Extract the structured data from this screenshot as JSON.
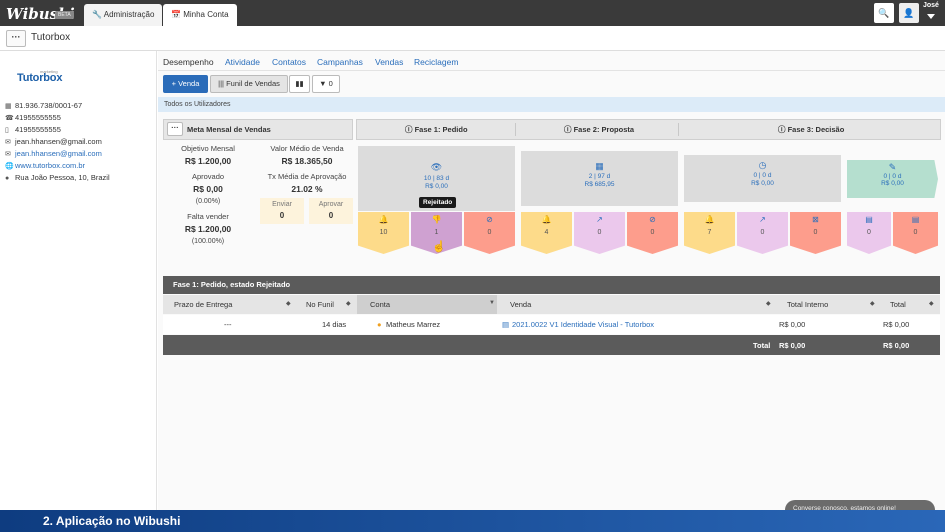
{
  "app": {
    "logo": "Wibushi",
    "beta": "BETA",
    "tabs": [
      {
        "label": "Administração"
      },
      {
        "label": "Minha Conta"
      }
    ],
    "username": "José"
  },
  "breadcrumb": {
    "title": "Tutorbox"
  },
  "company": {
    "tagline": "marketing",
    "name": "Tutorbox",
    "cnpj": "81.936.738/0001-67",
    "phone1": "41955555555",
    "phone2": "41955555555",
    "email1": "jean.hhansen@gmail.com",
    "email2": "jean.hhansen@gmail.com",
    "website": "www.tutorbox.com.br",
    "address": "Rua João Pessoa, 10, Brazil"
  },
  "nav": [
    "Desempenho",
    "Atividade",
    "Contatos",
    "Campanhas",
    "Vendas",
    "Reciclagem"
  ],
  "toolbar": {
    "add_label": "+ Venda",
    "funnel_label": "Funil de Vendas",
    "filter_count": "0"
  },
  "filter_bar": "Todos os Utilizadores",
  "meta": {
    "title": "Meta Mensal de Vendas",
    "objective_label": "Objetivo Mensal",
    "objective_value": "R$ 1.200,00",
    "approved_label": "Aprovado",
    "approved_value": "R$ 0,00",
    "approved_pct": "(0.00%)",
    "missing_label": "Falta vender",
    "missing_value": "R$ 1.200,00",
    "missing_pct": "(100.00%)",
    "avg_label": "Valor Médio de Venda",
    "avg_value": "R$ 18.365,50",
    "rate_label": "Tx Média de Aprovação",
    "rate_value": "21.02 %",
    "send_label": "Enviar",
    "send_value": "0",
    "approve_label": "Aprovar",
    "approve_value": "0"
  },
  "phases": [
    {
      "label": "Fase 1: Pedido"
    },
    {
      "label": "Fase 2: Proposta"
    },
    {
      "label": "Fase 3: Decisão"
    }
  ],
  "funnels": [
    {
      "line1": "10 | 83 d",
      "line2": "R$ 0,00"
    },
    {
      "line1": "2 | 97 d",
      "line2": "R$ 685,95"
    },
    {
      "line1": "0 | 0 d",
      "line2": "R$ 0,00"
    },
    {
      "line1": "0 | 0 d",
      "line2": "R$ 0,00"
    }
  ],
  "stages": [
    {
      "value": "10"
    },
    {
      "value": "1"
    },
    {
      "value": "0"
    },
    {
      "value": "4"
    },
    {
      "value": "0"
    },
    {
      "value": "0"
    },
    {
      "value": "7"
    },
    {
      "value": "0"
    },
    {
      "value": "0"
    },
    {
      "value": "0"
    },
    {
      "value": "0"
    }
  ],
  "tooltip": "Rejeitado",
  "table": {
    "title": "Fase 1: Pedido, estado Rejeitado",
    "headers": [
      "Prazo de Entrega",
      "No Funil",
      "Conta",
      "Venda",
      "Total Interno",
      "Total"
    ],
    "row": {
      "prazo": "---",
      "funil": "14 dias",
      "conta": "Matheus Marrez",
      "venda": "2021.0022 V1 Identidade Visual - Tutorbox",
      "total_interno": "R$ 0,00",
      "total": "R$ 0,00"
    },
    "footer": {
      "label": "Total",
      "total_interno": "R$ 0,00",
      "total": "R$ 0,00"
    }
  },
  "chat": "Converse conosco, estamos online!",
  "bottom_title": "2. Aplicação no Wibushi"
}
